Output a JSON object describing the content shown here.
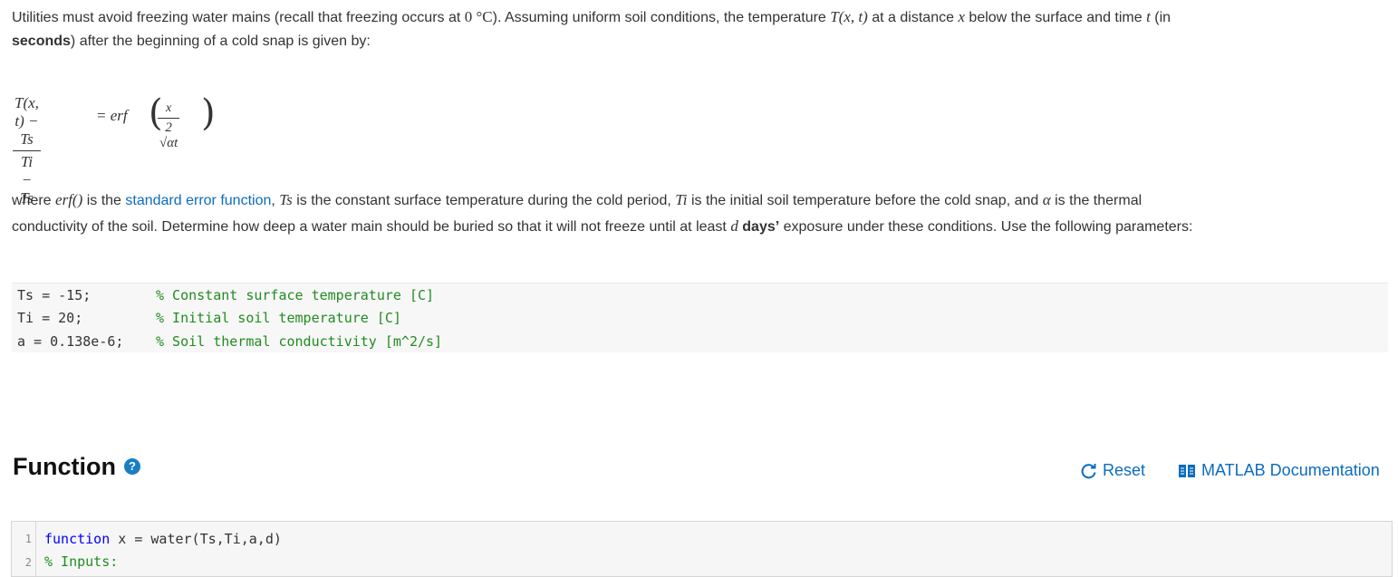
{
  "problem": {
    "p1": {
      "t1": "Utilities must avoid freezing water mains (recall that freezing occurs at ",
      "m_zero": "0 °C",
      "t2": "). Assuming uniform soil conditions, the temperature ",
      "m_Txt": "T(x, t)",
      "t3": " at a distance ",
      "m_x": "x",
      "t4": " below the surface and time ",
      "m_t": "t",
      "t5": " (in",
      "bold_seconds": "seconds",
      "t6": ") after the beginning of a cold snap is given by:"
    },
    "equation": {
      "lhs_num": "T(x, t) − Ts",
      "lhs_den": "Ti − Ts",
      "equals": "= erf",
      "rhs_num": "x",
      "rhs_den": "2 √αt"
    },
    "p2": {
      "t1": "where ",
      "m_erf": "erf()",
      "t2": " is the ",
      "link": "standard error function",
      "t3": ", ",
      "m_Ts": "Ts",
      "t4": " is the constant surface temperature during the cold period, ",
      "m_Ti": "Ti",
      "t5": " is the initial soil temperature before the cold snap, and ",
      "m_alpha": "α",
      "t6": " is the thermal",
      "t7": "conductivity of the soil. Determine how deep a water main should be buried so that it will not freeze until at least ",
      "m_d": "d",
      "bold_days": "days’",
      "t8": " exposure under these conditions. Use the following parameters:"
    }
  },
  "parameters": [
    {
      "code": "Ts = -15;",
      "comment": "% Constant surface temperature [C]"
    },
    {
      "code": "Ti = 20;",
      "comment": "% Initial soil temperature [C]"
    },
    {
      "code": "a = 0.138e-6;",
      "comment": "% Soil thermal conductivity [m^2/s]"
    }
  ],
  "function_section": {
    "title": "Function",
    "help_icon": "?",
    "reset_label": "Reset",
    "doc_label": "MATLAB Documentation"
  },
  "editor": {
    "lines": [
      {
        "num": "1",
        "keyword": "function",
        "rest": " x = water(Ts,Ti,a,d)"
      },
      {
        "num": "2",
        "comment": "% Inputs:"
      }
    ]
  }
}
